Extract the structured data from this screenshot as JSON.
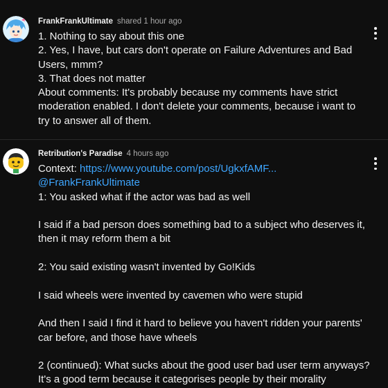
{
  "comments": [
    {
      "author": "FrankFrankUltimate",
      "time": "shared 1 hour ago",
      "avatar_icon": "anime-character-avatar",
      "lines": [
        "1. Nothing to say about this one",
        "2. Yes, I have, but cars don't operate on Failure Adventures and Bad",
        "Users, mmm?",
        "3. That does not matter",
        "About comments: It's probably because my comments have strict",
        "moderation enabled. I don't delete your comments, because i want to",
        "try to answer all of them."
      ]
    },
    {
      "author": "Retribution's Paradise",
      "time": "4 hours ago",
      "avatar_icon": "cartoon-character-avatar",
      "context_label": "Context: ",
      "context_link": "https://www.youtube.com/post/UgkxfAMF...",
      "mention": "@FrankFrankUltimate",
      "lines": [
        "1: You asked what if the actor was bad as well",
        "",
        "I said if a bad person does something bad to a subject who deserves it,",
        "then it may reform them a bit",
        "",
        "2: You said existing wasn't invented by Go!Kids",
        "",
        "I said wheels were invented by cavemen who were stupid",
        "",
        "And then I said I find it hard to believe you haven't ridden your parents'",
        "car before, and those have wheels",
        "",
        "2 (continued): What sucks about the good user bad user term anyways?",
        "It's a good term because it categorises people by their morality"
      ]
    }
  ],
  "colors": {
    "background": "#0f0f0f",
    "text": "#f1f1f1",
    "secondary_text": "#aaaaaa",
    "link": "#3ea6ff"
  }
}
